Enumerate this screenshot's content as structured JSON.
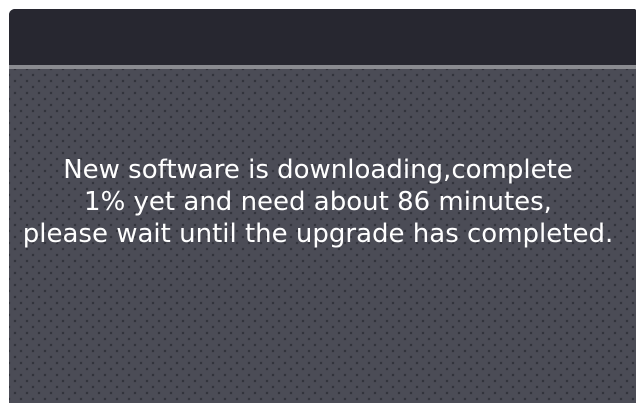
{
  "dialog": {
    "message_lines": [
      "New software is downloading,complete",
      "1% yet and need about 86 minutes,",
      "please wait until the upgrade has completed."
    ],
    "progress_percent": 1,
    "remaining_minutes": 86
  },
  "colors": {
    "window_background": "#2b2c35",
    "titlebar": "#272730",
    "divider": "#8a8b90",
    "hex_pattern": "#4b4c56",
    "text": "#ffffff"
  }
}
